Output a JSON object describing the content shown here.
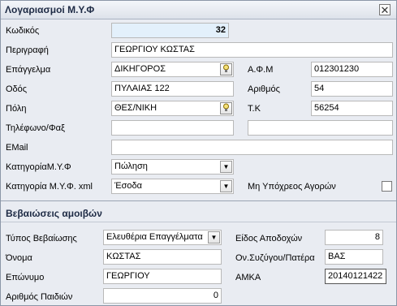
{
  "window": {
    "title": "Λογαριασμοί Μ.Υ.Φ",
    "close_glyph": "✕"
  },
  "form": {
    "kodikos_label": "Κωδικός",
    "kodikos_value": "32",
    "perigrafi_label": "Περιγραφή",
    "perigrafi_value": "ΓΕΩΡΓΙΟΥ ΚΩΣΤΑΣ",
    "epaggelma_label": "Επάγγελμα",
    "epaggelma_value": "ΔΙΚΗΓΟΡΟΣ",
    "afm_label": "Α.Φ.Μ",
    "afm_value": "012301230",
    "odos_label": "Οδός",
    "odos_value": "ΠΥΛΑΙΑΣ 122",
    "arithmos_label": "Αριθμός",
    "arithmos_value": "54",
    "poli_label": "Πόλη",
    "poli_value": "ΘΕΣ/ΝΙΚΗ",
    "tk_label": "Τ.Κ",
    "tk_value": "56254",
    "tilefono_label": "Τηλέφωνο/Φαξ",
    "tilefono_value": "",
    "fax_value": "",
    "email_label": "EMail",
    "email_value": "",
    "kategoria_label": "ΚατηγορίαΜ.Υ.Φ",
    "kategoria_value": "Πώληση",
    "kategoria_xml_label": "Κατηγορία Μ.Υ.Φ. xml",
    "kategoria_xml_value": "Έσοδα",
    "mi_ypoxreos_label": "Μη Υπόχρεος Αγορών",
    "mi_ypoxreos_checked": false
  },
  "section2": {
    "title": "Βεβαιώσεις αμοιβών",
    "typos_label": "Τύπος Βεβαίωσης",
    "typos_value": "Ελευθέρια Επαγγέλματα",
    "eidos_label": "Είδος Αποδοχών",
    "eidos_value": "8",
    "onoma_label": "Όνομα",
    "onoma_value": "ΚΩΣΤΑΣ",
    "syzygos_label": "Ον.Συζύγου/Πατέρα",
    "syzygos_value": "ΒΑΣ",
    "eponymo_label": "Επώνυμο",
    "eponymo_value": "ΓΕΩΡΓΙΟΥ",
    "amka_label": "ΑΜΚΑ",
    "amka_value": "20140121422",
    "paidia_label": "Αριθμός Παιδιών",
    "paidia_value": "0"
  },
  "icons": {
    "lookup": "lookup-icon",
    "dropdown": "▼"
  }
}
